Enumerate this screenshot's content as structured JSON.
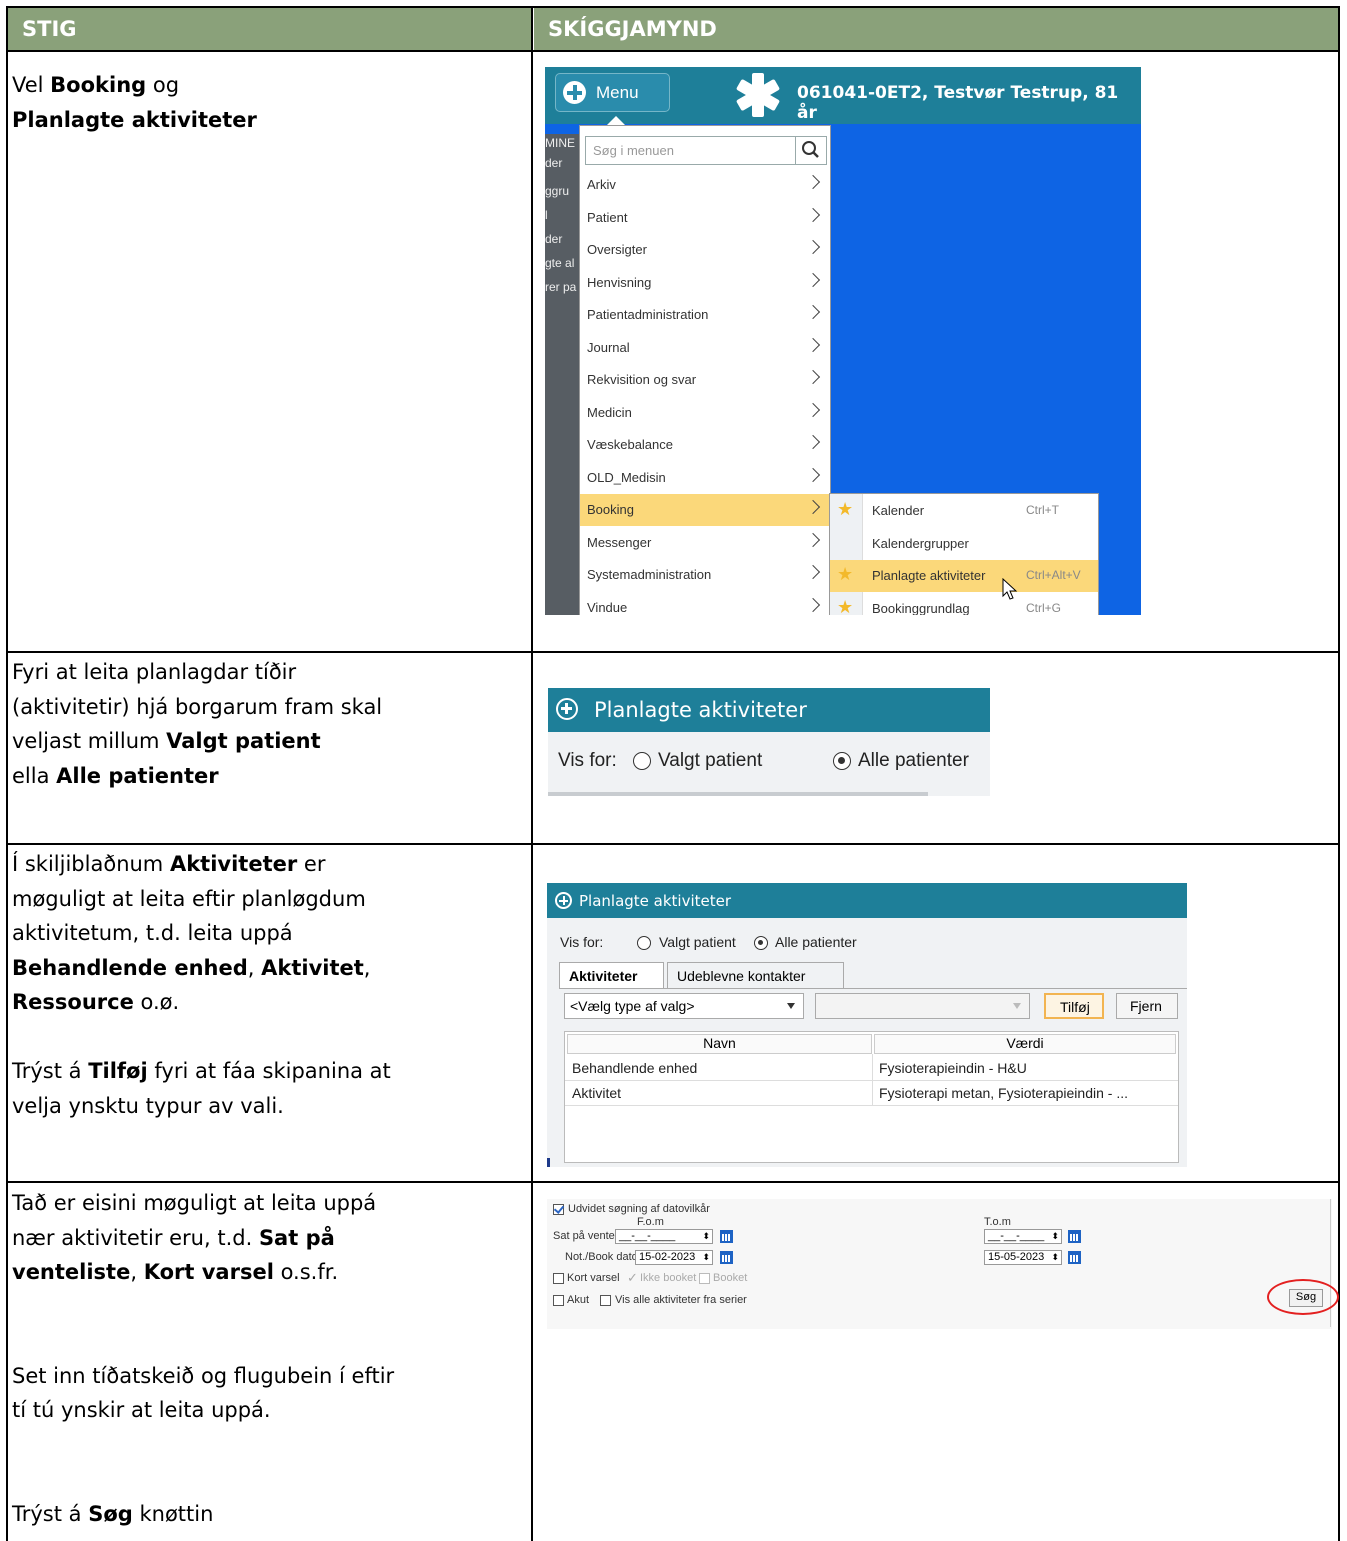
{
  "header": {
    "col1": "STIG",
    "col2": "SKÍGGJAMYND"
  },
  "rows": [
    {
      "text": [
        [
          "Vel ",
          {
            "b": "Booking"
          },
          " og"
        ],
        [
          {
            "b": "Planlagte aktiviteter"
          }
        ]
      ]
    },
    {
      "text": [
        [
          "Fyri at leita planlagdar tíðir"
        ],
        [
          "(aktivitetir) hjá borgarum fram skal"
        ],
        [
          "veljast millum ",
          {
            "b": "Valgt patient"
          }
        ],
        [
          "ella ",
          {
            "b": "Alle patienter"
          }
        ]
      ]
    },
    {
      "text": [
        [
          "Í skiljiblaðnum ",
          {
            "b": "Aktiviteter"
          },
          " er"
        ],
        [
          "møguligt at leita eftir planløgdum"
        ],
        [
          "aktivitetum, t.d. leita uppá"
        ],
        [
          {
            "b": "Behandlende enhed"
          },
          ", ",
          {
            "b": "Aktivitet"
          },
          ","
        ],
        [
          {
            "b": "Ressource"
          },
          " o.ø."
        ],
        [
          ""
        ],
        [
          "Trýst á ",
          {
            "b": "Tilføj"
          },
          " fyri at fáa skipanina at"
        ],
        [
          "velja ynsktu typur av vali."
        ]
      ]
    },
    {
      "text": [
        [
          "Tað er eisini møguligt at leita uppá"
        ],
        [
          "nær aktivitetir eru, t.d. ",
          {
            "b": "Sat på"
          }
        ],
        [
          {
            "b": "venteliste"
          },
          ", ",
          {
            "b": "Kort varsel"
          },
          " o.s.fr."
        ],
        [
          ""
        ],
        [
          ""
        ],
        [
          "Set inn tíðatskeið og flugubein í eftir"
        ],
        [
          "tí tú ynskir at leita uppá."
        ],
        [
          ""
        ],
        [
          ""
        ],
        [
          "Trýst á ",
          {
            "b": "Søg"
          },
          " knøttin"
        ]
      ]
    }
  ],
  "shot1": {
    "menu_button": "Menu",
    "patient": "061041-0ET2, Testvør Testrup, 81 år",
    "sidebar_fragments": [
      "MINE",
      "der",
      "ggru",
      "l",
      "der",
      "gte al",
      "rer pa"
    ],
    "search_placeholder": "Søg i menuen",
    "menu_items": [
      "Arkiv",
      "Patient",
      "Oversigter",
      "Henvisning",
      "Patientadministration",
      "Journal",
      "Rekvisition og svar",
      "Medicin",
      "Væskebalance",
      "OLD_Medisin",
      "Booking",
      "Messenger",
      "Systemadministration",
      "Vindue"
    ],
    "highlighted_item": "Booking",
    "submenu": [
      {
        "label": "Kalender",
        "key": "Ctrl+T",
        "star": true
      },
      {
        "label": "Kalendergrupper",
        "key": "",
        "star": false
      },
      {
        "label": "Planlagte aktiviteter",
        "key": "Ctrl+Alt+V",
        "star": true,
        "highlight": true
      },
      {
        "label": "Bookinggrundlag",
        "key": "Ctrl+G",
        "star": true
      }
    ],
    "colors": {
      "topbar": "#1e7f99",
      "workspace": "#0e64e4",
      "highlight": "#fbd87a"
    }
  },
  "shot2": {
    "title": "Planlagte aktiviteter",
    "vis_for": "Vis for:",
    "radio1": "Valgt patient",
    "radio2": "Alle patienter",
    "selected": "Alle patienter"
  },
  "shot3": {
    "title": "Planlagte aktiviteter",
    "vis_for": "Vis for:",
    "radio1": "Valgt patient",
    "radio2": "Alle patienter",
    "tab_active": "Aktiviteter",
    "tab_other": "Udeblevne kontakter",
    "combo_value": "<Vælg type af valg>",
    "btn_add": "Tilføj",
    "btn_remove": "Fjern",
    "grid_headers": [
      "Navn",
      "Værdi"
    ],
    "grid_rows": [
      [
        "Behandlende enhed",
        "Fysioterapieindin - H&U"
      ],
      [
        "Aktivitet",
        "Fysioterapi metan, Fysioterapieindin - ..."
      ]
    ]
  },
  "shot4": {
    "extended_search": "Udvidet søgning af datovilkår",
    "from_label": "F.o.m",
    "to_label": "T.o.m",
    "row1_label": "Sat på venteliste",
    "row1_from": "__-__-____",
    "row1_to": "__-__-____",
    "row2_label": "Not./Book dato",
    "row2_from": "15-02-2023",
    "row2_to": "15-05-2023",
    "kort_varsel": "Kort varsel",
    "ikke_booket": "Ikke booket",
    "booket": "Booket",
    "akut": "Akut",
    "vis_alle": "Vis alle aktiviteter fra serier",
    "search_button": "Søg"
  }
}
